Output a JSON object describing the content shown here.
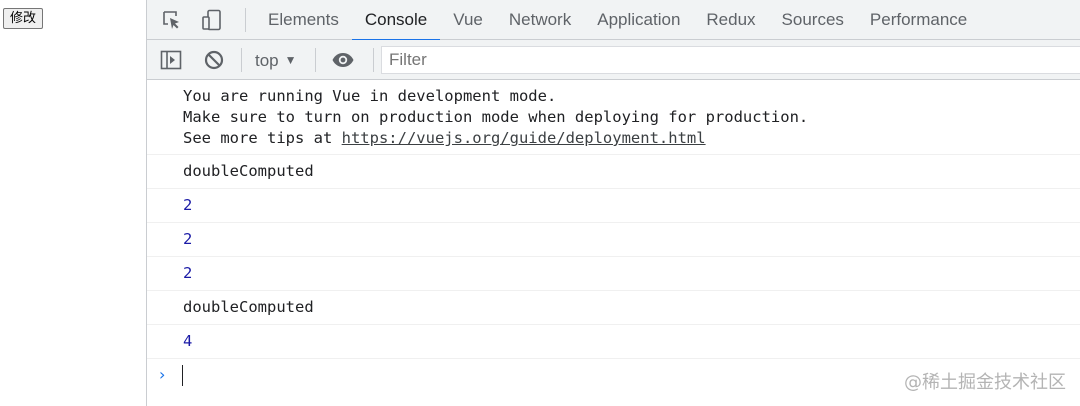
{
  "page": {
    "modify_button": "修改"
  },
  "devtools": {
    "tabs": [
      {
        "label": "Elements"
      },
      {
        "label": "Console"
      },
      {
        "label": "Vue"
      },
      {
        "label": "Network"
      },
      {
        "label": "Application"
      },
      {
        "label": "Redux"
      },
      {
        "label": "Sources"
      },
      {
        "label": "Performance"
      }
    ],
    "active_tab": "Console",
    "accent_color": "#1a73e8",
    "toolbar": {
      "context": "top",
      "filter_placeholder": "Filter"
    },
    "console": {
      "vue_notice": {
        "line1": "You are running Vue in development mode.",
        "line2": "Make sure to turn on production mode when deploying for production.",
        "line3_prefix": "See more tips at ",
        "link": "https://vuejs.org/guide/deployment.html"
      },
      "messages": [
        "doubleComputed",
        "2",
        "2",
        "2",
        "doubleComputed",
        "4"
      ],
      "prompt_symbol": "›"
    }
  },
  "watermark": "@稀土掘金技术社区"
}
